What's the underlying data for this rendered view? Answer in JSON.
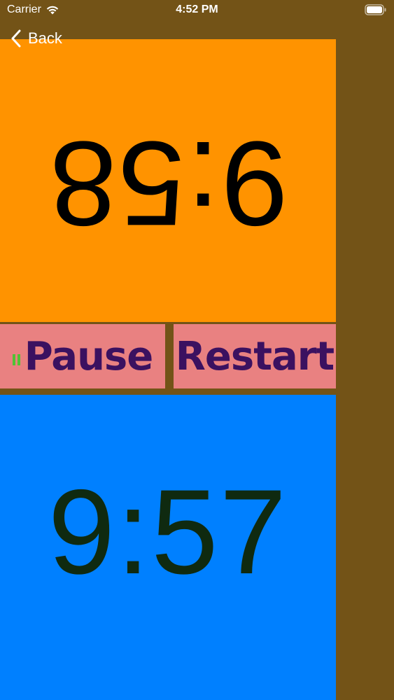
{
  "status_bar": {
    "carrier": "Carrier",
    "time": "4:52 PM"
  },
  "nav": {
    "back_label": "Back"
  },
  "timers": {
    "top_player": "9:58",
    "bottom_player": "9:57"
  },
  "controls": {
    "pause_label": "Pause",
    "restart_label": "Restart"
  },
  "colors": {
    "background": "#735317",
    "top_panel": "#FF9300",
    "bottom_panel": "#0080FF",
    "button_bg": "#E98181",
    "button_text": "#3B1160"
  }
}
